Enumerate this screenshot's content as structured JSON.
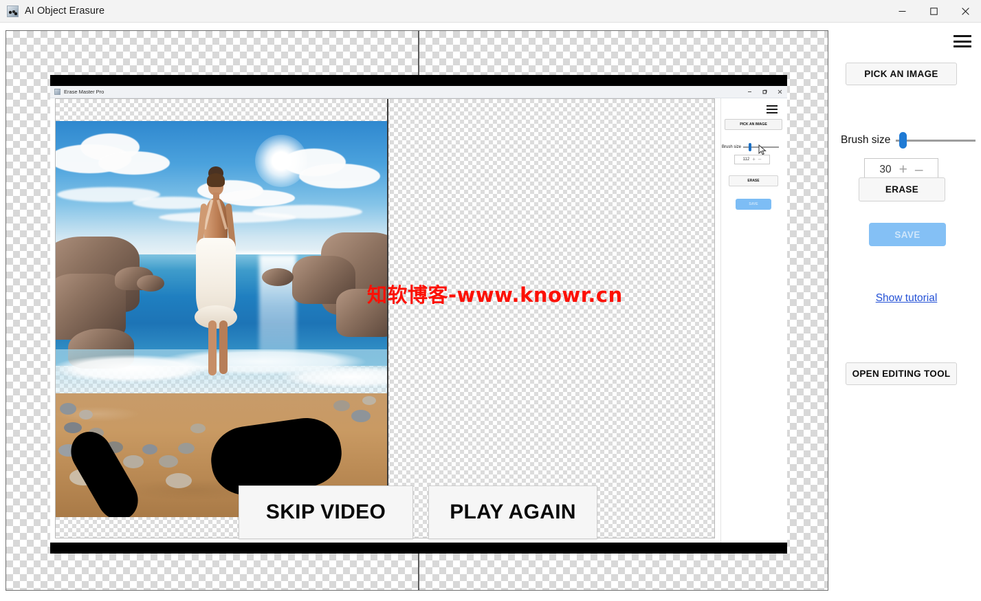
{
  "window": {
    "title": "AI Object Erasure",
    "icon": "app-icon",
    "controls": {
      "minimize": "minimize-icon",
      "maximize": "maximize-icon",
      "close": "close-icon"
    }
  },
  "sidebar": {
    "menu_icon": "hamburger-menu-icon",
    "pick_image_label": "PICK AN IMAGE",
    "brush_size_label": "Brush size",
    "brush_size_value": "30",
    "stepper_plus": "+",
    "stepper_minus": "–",
    "erase_label": "ERASE",
    "save_label": "SAVE",
    "tutorial_link": "Show tutorial",
    "open_editing_label": "OPEN EDITING TOOL",
    "accent_color": "#1f7ad4",
    "save_color": "#84c0f5",
    "link_color": "#2451d6"
  },
  "video_overlay": {
    "skip_label": "SKIP VIDEO",
    "play_again_label": "PLAY AGAIN"
  },
  "inner_app": {
    "title": "Erase Master Pro",
    "menu_icon": "hamburger-menu-icon",
    "pick_image_label": "PICK AN IMAGE",
    "brush_size_label": "Brush size",
    "brush_size_value": "112",
    "stepper_plus": "+",
    "stepper_minus": "–",
    "erase_label": "ERASE",
    "save_label": "SAVE",
    "cursor": "mouse-pointer-icon"
  },
  "canvas": {
    "image_description": "beach-photo-woman-in-white-dress",
    "mask_strokes": 2,
    "watermark": "知软博客-www.knowr.cn",
    "watermark_color": "#fc1005"
  }
}
